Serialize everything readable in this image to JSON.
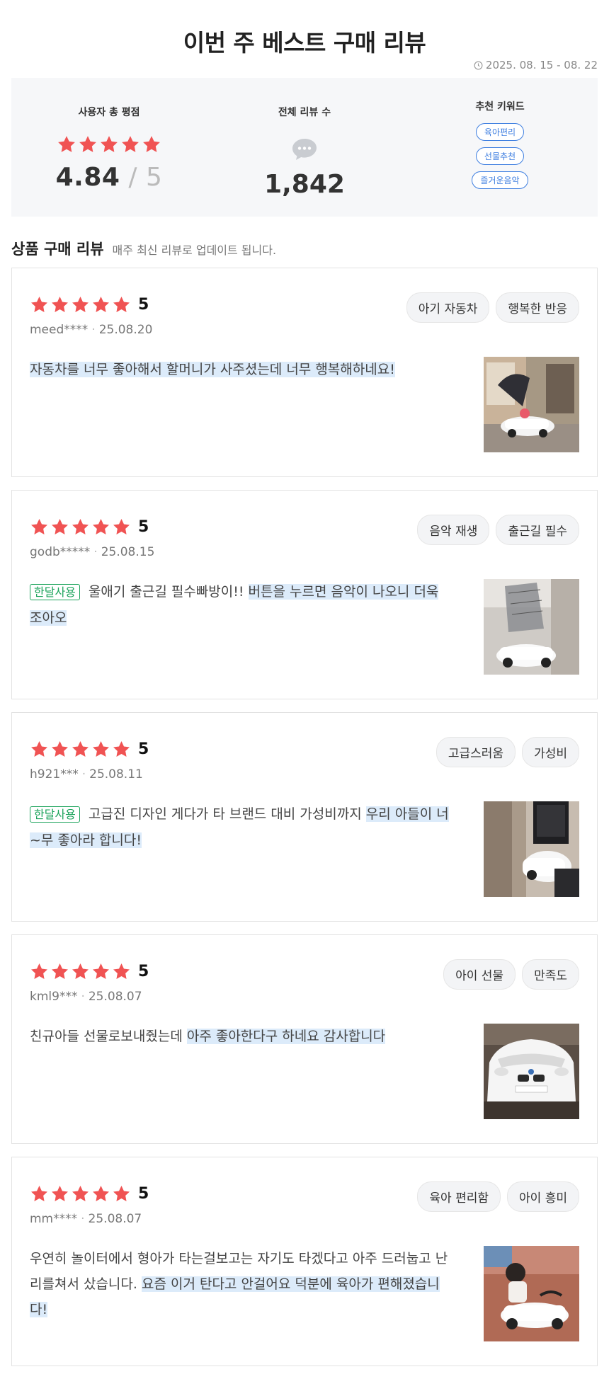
{
  "header": {
    "title": "이번 주 베스트 구매 리뷰",
    "date_range": "2025. 08. 15 - 08. 22"
  },
  "summary": {
    "rating_label": "사용자 총 평점",
    "rating_value": "4.84",
    "rating_max": "5",
    "star_count": 5,
    "review_count_label": "전체 리뷰 수",
    "review_count": "1,842",
    "keywords_label": "추천 키워드",
    "keywords": [
      "육아편리",
      "선물추천",
      "즐거운음악"
    ]
  },
  "section": {
    "title": "상품 구매 리뷰",
    "description": "매주 최신 리뷰로 업데이트 됩니다."
  },
  "colors": {
    "star": "#f05353",
    "highlight": "#dcebfa",
    "keyword": "#3d7ee0",
    "month_badge": "#1aa35a"
  },
  "reviews": [
    {
      "score": "5",
      "user": "meed****",
      "date": "25.08.20",
      "tags": [
        "아기 자동차",
        "행복한 반응"
      ],
      "badge": "",
      "text_plain": "",
      "text_highlight": "자동차를 너무 좋아해서 할머니가 사주셨는데 너무 행복해하네요!"
    },
    {
      "score": "5",
      "user": "godb*****",
      "date": "25.08.15",
      "tags": [
        "음악 재생",
        "출근길 필수"
      ],
      "badge": "한달사용",
      "text_plain": "울애기 출근길 필수빠방이!! ",
      "text_highlight": "버튼을 누르면 음악이 나오니 더욱 조아오"
    },
    {
      "score": "5",
      "user": "h921***",
      "date": "25.08.11",
      "tags": [
        "고급스러움",
        "가성비"
      ],
      "badge": "한달사용",
      "text_plain": "고급진 디자인 게다가 타 브랜드 대비 가성비까지 ",
      "text_highlight": "우리 아들이 너~무 좋아라 합니다!"
    },
    {
      "score": "5",
      "user": "kml9***",
      "date": "25.08.07",
      "tags": [
        "아이 선물",
        "만족도"
      ],
      "badge": "",
      "text_plain": "친규아들 선물로보내줬는데 ",
      "text_highlight": "아주 좋아한다구 하네요 감사합니다"
    },
    {
      "score": "5",
      "user": "mm****",
      "date": "25.08.07",
      "tags": [
        "육아 편리함",
        "아이 흥미"
      ],
      "badge": "",
      "text_plain": "우연히 놀이터에서 형아가 타는걸보고는 자기도 타겠다고 아주 드러눕고 난리를쳐서 샀습니다. ",
      "text_highlight": "요즘 이거 탄다고 안걸어요 덕분에 육아가 편해졌습니다!"
    }
  ]
}
